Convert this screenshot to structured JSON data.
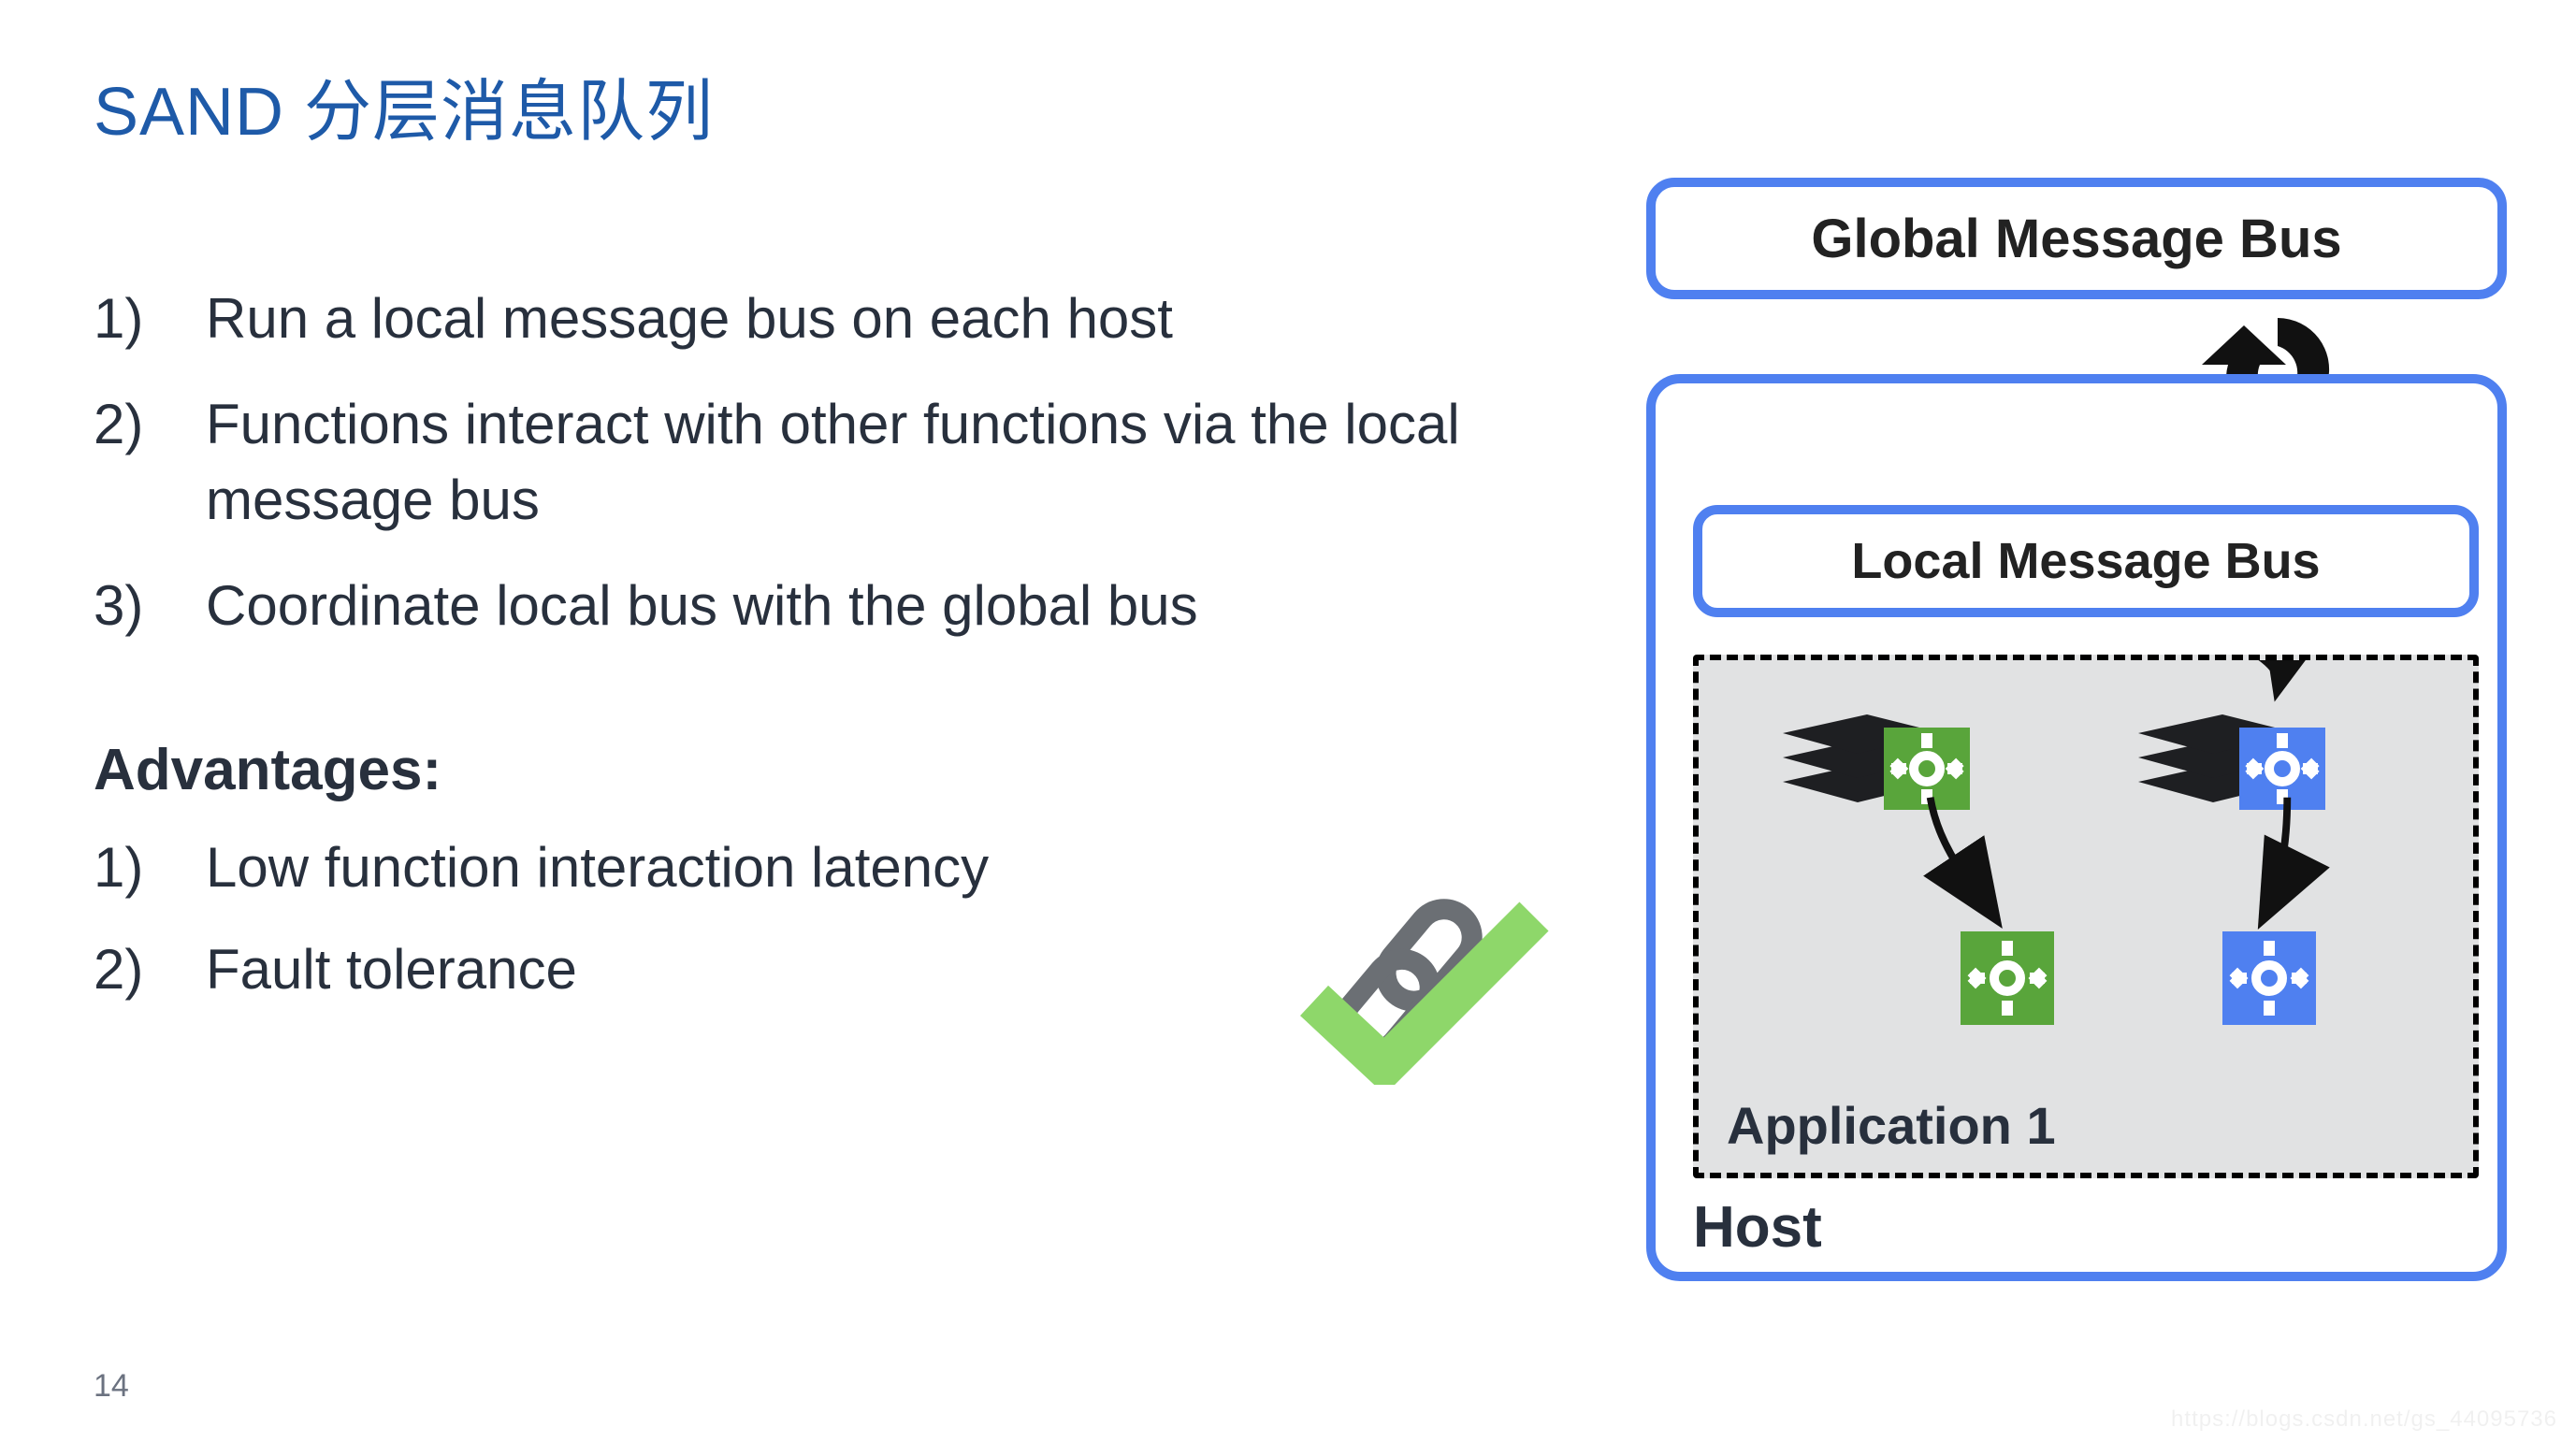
{
  "title": "SAND 分层消息队列",
  "points": {
    "p1": "Run a local message bus on each host",
    "p2": "Functions interact with other functions via the local message bus",
    "p3": "Coordinate local bus with the global bus"
  },
  "advantages_header": "Advantages:",
  "advantages": {
    "a1": "Low function interaction latency",
    "a2": "Fault tolerance"
  },
  "diagram": {
    "global_bus": "Global Message Bus",
    "local_bus": "Local Message Bus",
    "application": "Application 1",
    "host": "Host",
    "colors": {
      "border": "#4f80f0",
      "green": "#59a53b",
      "blue": "#4f80f0",
      "app_bg": "#e1e2e3"
    },
    "icons": {
      "sync": "sync-icon",
      "server_stack": "server-stack-icon",
      "gear": "gear-icon",
      "checkmark_chain": "checkmark-chain-icon"
    }
  },
  "page_number": "14",
  "watermark": "https://blogs.csdn.net/gs_44095736"
}
